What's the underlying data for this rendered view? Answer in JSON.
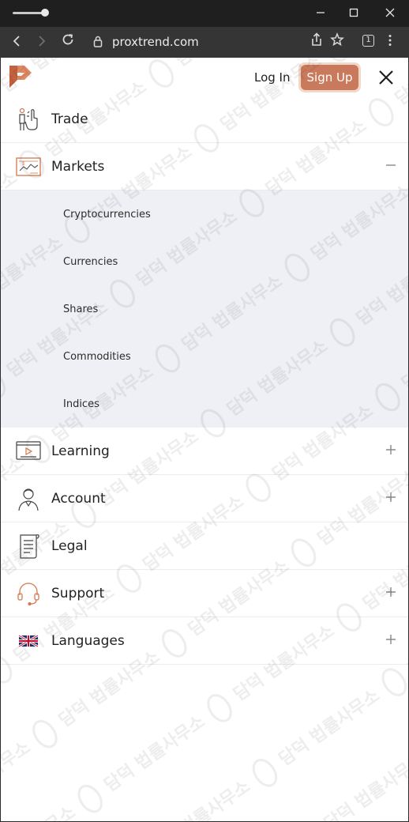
{
  "browser": {
    "url": "proxtrend.com",
    "tab_count": "1"
  },
  "header": {
    "login_label": "Log In",
    "signup_label": "Sign Up"
  },
  "menu": {
    "items": [
      {
        "label": "Trade",
        "icon": "trade-icon",
        "toggle": "none"
      },
      {
        "label": "Markets",
        "icon": "markets-icon",
        "toggle": "minus"
      },
      {
        "label": "Learning",
        "icon": "learning-icon",
        "toggle": "plus"
      },
      {
        "label": "Account",
        "icon": "account-icon",
        "toggle": "plus"
      },
      {
        "label": "Legal",
        "icon": "legal-icon",
        "toggle": "none"
      },
      {
        "label": "Support",
        "icon": "support-icon",
        "toggle": "plus"
      },
      {
        "label": "Languages",
        "icon": "uk-flag-icon",
        "toggle": "plus"
      }
    ],
    "markets_submenu": [
      "Cryptocurrencies",
      "Currencies",
      "Shares",
      "Commodities",
      "Indices"
    ]
  },
  "watermark_text": "담덕 법률사무소",
  "colors": {
    "accent": "#c97a5c",
    "submenu_bg": "#eef0f5"
  }
}
